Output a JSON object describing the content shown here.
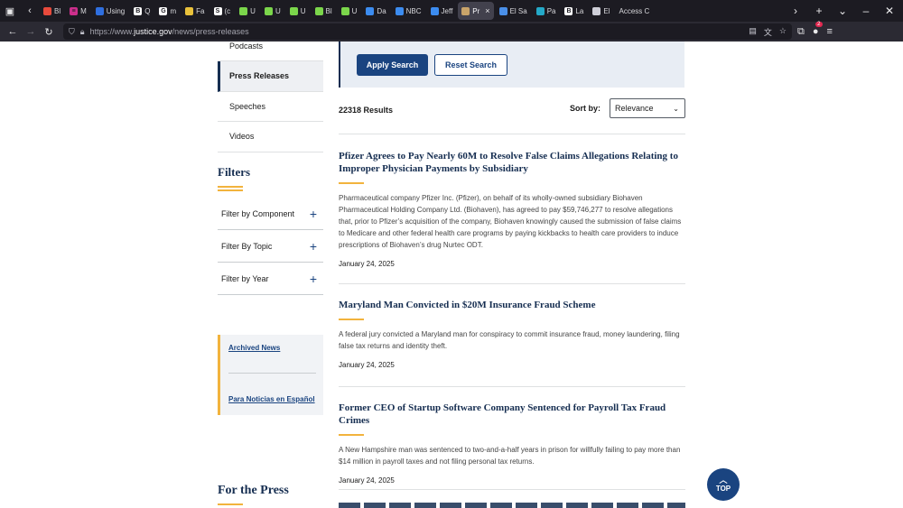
{
  "browser": {
    "tabs": [
      {
        "label": "Bl",
        "color": "#e84a3c",
        "glyph": ""
      },
      {
        "label": "M",
        "color": "#cc2f8c",
        "glyph": "≡"
      },
      {
        "label": "Using",
        "color": "#2f6fe0",
        "glyph": ""
      },
      {
        "label": "Q",
        "color": "#ffffff",
        "glyph": "B"
      },
      {
        "label": "m",
        "color": "#ffffff",
        "glyph": "G"
      },
      {
        "label": "Fa",
        "color": "#e9c13b",
        "glyph": ""
      },
      {
        "label": "(c",
        "color": "#ffffff",
        "glyph": "S"
      },
      {
        "label": "U",
        "color": "#7bd64b",
        "glyph": ""
      },
      {
        "label": "U",
        "color": "#7bd64b",
        "glyph": ""
      },
      {
        "label": "U",
        "color": "#7bd64b",
        "glyph": ""
      },
      {
        "label": "Bl",
        "color": "#7bd64b",
        "glyph": ""
      },
      {
        "label": "U",
        "color": "#7bd64b",
        "glyph": ""
      },
      {
        "label": "Da",
        "color": "#3c8cf0",
        "glyph": ""
      },
      {
        "label": "NBC",
        "color": "#3c8cf0",
        "glyph": ""
      },
      {
        "label": "Jeff",
        "color": "#3c8cf0",
        "glyph": ""
      },
      {
        "label": "Pr",
        "color": "#c9a46a",
        "glyph": "",
        "active": true
      },
      {
        "label": "El Sa",
        "color": "#4a8fe8",
        "glyph": ""
      },
      {
        "label": "Pa",
        "color": "#24a9c8",
        "glyph": ""
      },
      {
        "label": "La",
        "color": "#ffffff",
        "glyph": "B"
      },
      {
        "label": "El",
        "color": "#cfcfd8",
        "glyph": ""
      },
      {
        "label": "Access C",
        "color": "",
        "glyph": ""
      }
    ],
    "url_prefix": "https://www.",
    "url_domain": "justice.gov",
    "url_path": "/news/press-releases",
    "notification_count": "2"
  },
  "sidenav": {
    "items": [
      "Podcasts",
      "Press Releases",
      "Speeches",
      "Videos"
    ]
  },
  "filters": {
    "title": "Filters",
    "rows": [
      "Filter by Component",
      "Filter By Topic",
      "Filter by Year"
    ]
  },
  "archive": {
    "archived_news": "Archived News",
    "spanish": "Para Noticias en Español"
  },
  "press_title": "For the Press",
  "search": {
    "apply_label": "Apply Search",
    "reset_label": "Reset Search"
  },
  "results": {
    "count": "22318 Results",
    "sort_label": "Sort by:",
    "sort_value": "Relevance"
  },
  "articles": [
    {
      "title": "Pfizer Agrees to Pay Nearly 60M to Resolve False Claims Allegations Relating to Improper Physician Payments by Subsidiary",
      "body": "Pharmaceutical company Pfizer Inc. (Pfizer), on behalf of its wholly-owned subsidiary Biohaven Pharmaceutical Holding Company Ltd. (Biohaven), has agreed to pay $59,746,277 to resolve allegations that, prior to Pfizer’s acquisition of the company, Biohaven knowingly caused the submission of false claims to Medicare and other federal health care programs by paying kickbacks to health care providers to induce prescriptions of Biohaven’s drug Nurtec ODT.",
      "date": "January 24, 2025"
    },
    {
      "title": "Maryland Man Convicted in $20M Insurance Fraud Scheme",
      "body": "A federal jury convicted a Maryland man for conspiracy to commit insurance fraud, money laundering, filing false tax returns and identity theft.",
      "date": "January 24, 2025"
    },
    {
      "title": "Former CEO of Startup Software Company Sentenced for Payroll Tax Fraud Crimes",
      "body": "A New Hampshire man was sentenced to two-and-a-half years in prison for willfully failing to pay more than $14 million in payroll taxes and not filing personal tax returns.",
      "date": "January 24, 2025"
    }
  ],
  "top_button": "TOP"
}
